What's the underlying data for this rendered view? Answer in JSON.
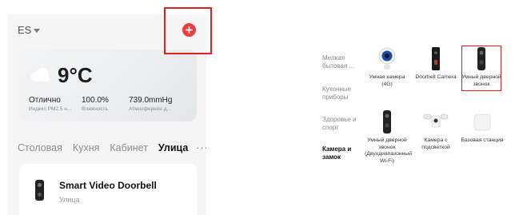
{
  "left": {
    "home_name": "ES",
    "weather": {
      "temperature": "9°C",
      "stats": [
        {
          "value": "Отлично",
          "label": "Индекс PM2.5 н..."
        },
        {
          "value": "100.0%",
          "label": "Влажность"
        },
        {
          "value": "739.0mmHg",
          "label": "Атмосферное д..."
        }
      ]
    },
    "rooms": [
      "Столовая",
      "Кухня",
      "Кабинет",
      "Улица"
    ],
    "active_room": "Улица",
    "more_glyph": "···",
    "device": {
      "name": "Smart Video Doorbell",
      "room": "Улица"
    },
    "colors": {
      "add_button": "#ef3b3b",
      "highlight": "#e02020"
    }
  },
  "right": {
    "categories": [
      {
        "label": "Мелкая бытовая ...",
        "active": false
      },
      {
        "label": "Кухонные приборы",
        "active": false
      },
      {
        "label": "Здоровье и спорт",
        "active": false
      },
      {
        "label": "Камера и замок",
        "active": true
      }
    ],
    "products": [
      {
        "label": "Умная камера (4G)",
        "icon": "camera-4g-icon"
      },
      {
        "label": "Doorbell Camera",
        "icon": "doorbell-camera-icon"
      },
      {
        "label": "Умный дверной звонок",
        "icon": "smart-doorbell-icon",
        "highlighted": true
      },
      {
        "label": "Умный дверной звонок (Двухдиапазонный Wi-Fi)",
        "icon": "doorbell-dualband-icon"
      },
      {
        "label": "Камера с подсветкой",
        "icon": "floodlight-camera-icon"
      },
      {
        "label": "Базовая станция",
        "icon": "base-station-icon"
      }
    ]
  }
}
